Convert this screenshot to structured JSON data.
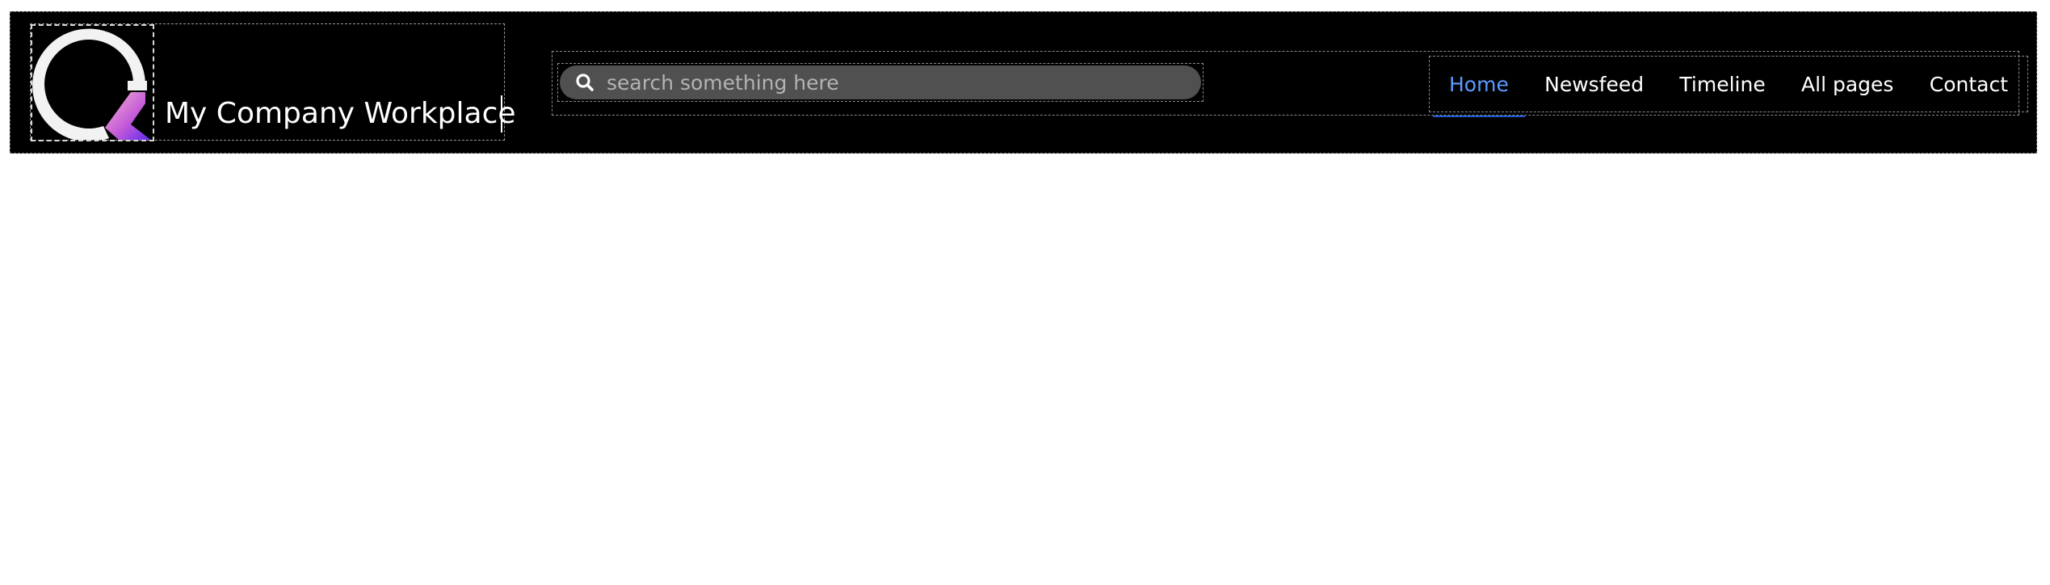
{
  "brand": {
    "logo_icon": "q-letter-logo",
    "name": "My Company Workplace"
  },
  "search": {
    "icon": "search-icon",
    "placeholder": "search something here",
    "value": ""
  },
  "nav": {
    "items": [
      {
        "label": "Home",
        "active": true
      },
      {
        "label": "Newsfeed",
        "active": false
      },
      {
        "label": "Timeline",
        "active": false
      },
      {
        "label": "All pages",
        "active": false
      },
      {
        "label": "Contact",
        "active": false
      }
    ]
  },
  "colors": {
    "header_background": "#000000",
    "search_background": "#505050",
    "active_link": "#5b9bff",
    "logo_gradient_start": "#f5a3c7",
    "logo_gradient_end": "#6b2cf5"
  }
}
